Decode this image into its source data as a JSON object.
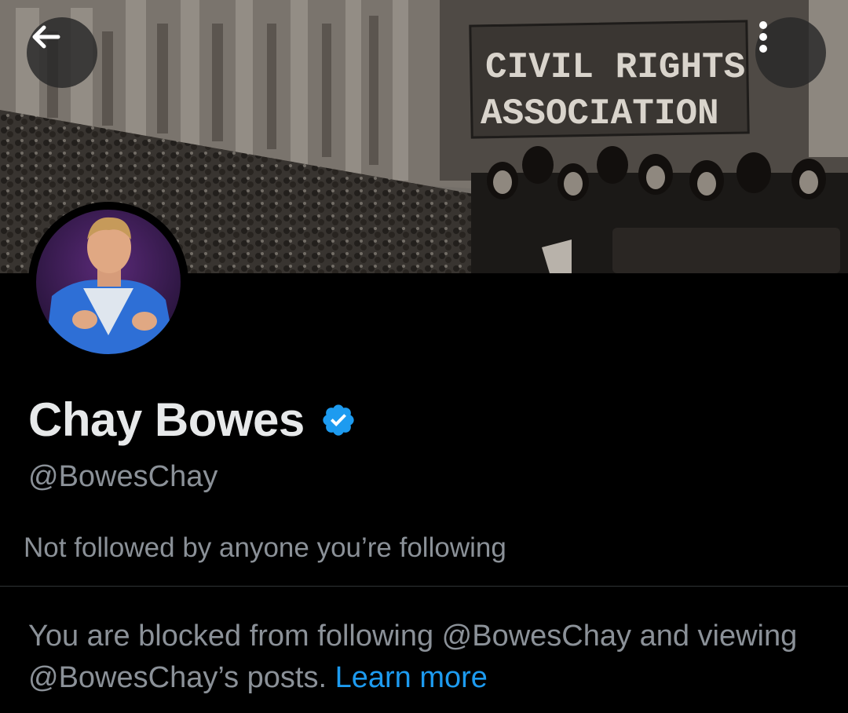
{
  "header": {
    "back_icon": "arrow-left-icon",
    "more_icon": "more-vertical-icon",
    "banner_sign_line1": "CIVIL RIGHTS",
    "banner_sign_line2": "ASSOCIATION"
  },
  "profile": {
    "name": "Chay Bowes",
    "verified_icon": "verified-badge-icon",
    "handle": "@BowesChay",
    "followed_by": "Not followed by anyone you’re following"
  },
  "blocked_notice": {
    "text": "You are blocked from following @BowesChay and viewing @BowesChay’s posts. ",
    "link": "Learn more"
  },
  "colors": {
    "background": "#000000",
    "primary_text": "#e7e9ea",
    "secondary_text": "#8b9198",
    "link": "#1d9bf0",
    "verified": "#1d9bf0"
  }
}
